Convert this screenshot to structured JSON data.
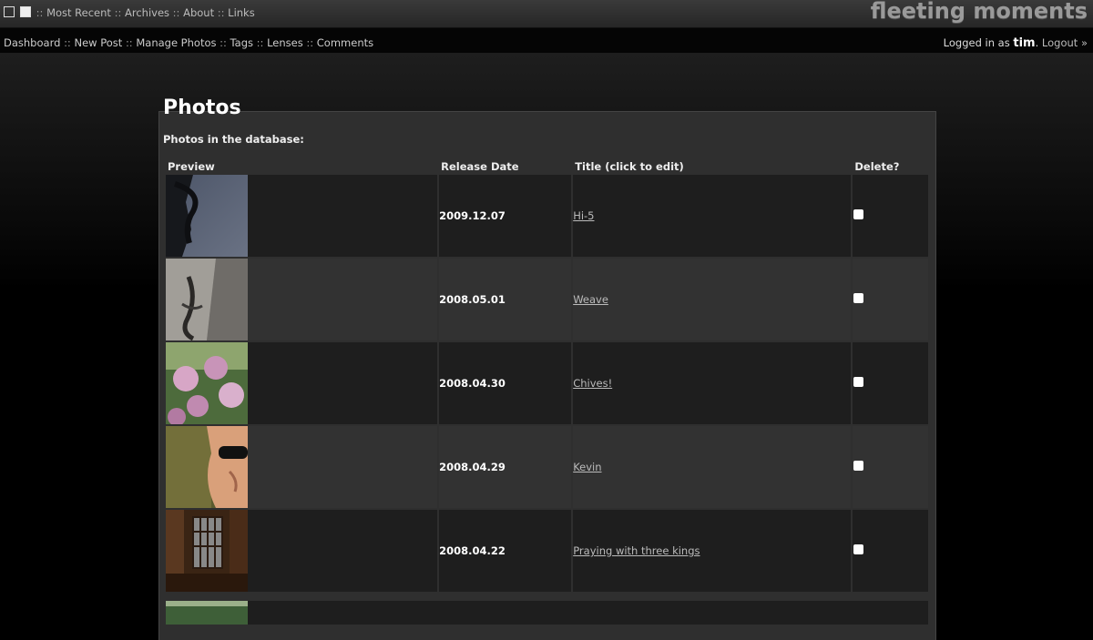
{
  "top_nav": {
    "links": [
      "Most Recent",
      "Archives",
      "About",
      "Links"
    ],
    "logo": "fleeting moments"
  },
  "admin_nav": {
    "links": [
      "Dashboard",
      "New Post",
      "Manage Photos",
      "Tags",
      "Lenses",
      "Comments"
    ],
    "logged_in_prefix": "Logged in as",
    "username": "tim",
    "logout": "Logout »"
  },
  "page": {
    "title": "Photos",
    "intro": "Photos in the database:"
  },
  "table": {
    "headers": [
      "Preview",
      "Release Date",
      "Title (click to edit)",
      "Delete?"
    ],
    "rows": [
      {
        "date": "2009.12.07",
        "title": "Hi-5"
      },
      {
        "date": "2008.05.01",
        "title": "Weave"
      },
      {
        "date": "2008.04.30",
        "title": "Chives!"
      },
      {
        "date": "2008.04.29",
        "title": "Kevin"
      },
      {
        "date": "2008.04.22",
        "title": "Praying with three kings"
      }
    ]
  },
  "colors": {
    "background": "#000000",
    "panel": "#2f2f2f",
    "row_dark": "#1e1e1e",
    "row_light": "#323232",
    "link": "#bbbbbb"
  }
}
